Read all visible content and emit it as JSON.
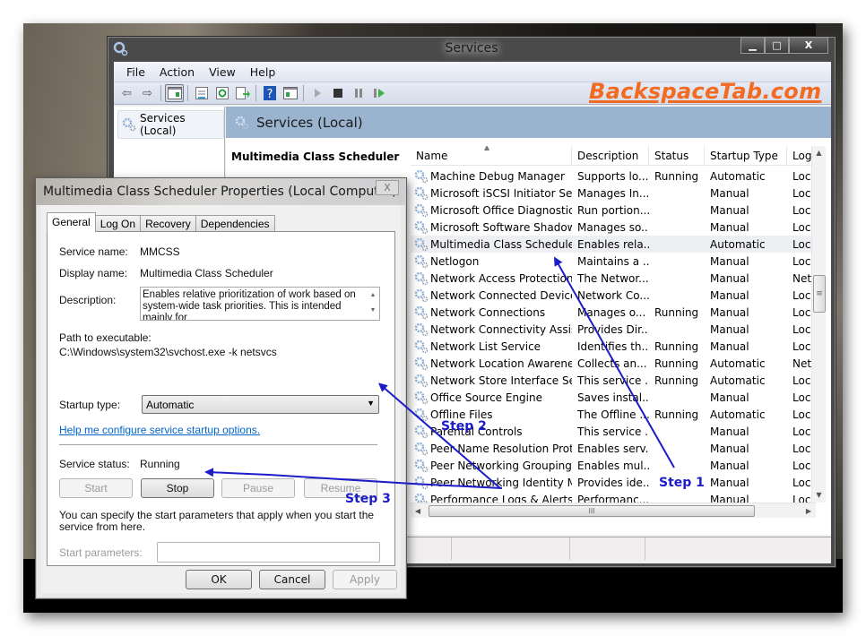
{
  "services_window": {
    "title": "Services",
    "controls": {
      "minimize": "▁",
      "maximize": "□",
      "close": "X"
    },
    "menu": [
      "File",
      "Action",
      "View",
      "Help"
    ],
    "toolbar_icons": [
      "back-arrow-icon",
      "forward-arrow-icon",
      "show-hide-console-tree-icon",
      "properties-icon",
      "refresh-icon",
      "export-list-icon",
      "help-icon",
      "show-hide-action-pane-icon",
      "start-service-icon",
      "stop-service-icon",
      "pause-service-icon",
      "restart-service-icon"
    ],
    "watermark": "BackspaceTab.com",
    "brand_color": "#f36a21",
    "tree": {
      "root": "Services (Local)"
    },
    "content_header": "Services (Local)",
    "selected_detail_title": "Multimedia Class Scheduler",
    "columns": [
      "Name",
      "Description",
      "Status",
      "Startup Type",
      "Log"
    ],
    "rows": [
      {
        "name": "Machine Debug Manager",
        "description": "Supports lo...",
        "status": "Running",
        "startup": "Automatic",
        "log": "Loc"
      },
      {
        "name": "Microsoft iSCSI Initiator Ser...",
        "description": "Manages In...",
        "status": "",
        "startup": "Manual",
        "log": "Loc"
      },
      {
        "name": "Microsoft Office Diagnostic...",
        "description": "Run portion...",
        "status": "",
        "startup": "Manual",
        "log": "Loc"
      },
      {
        "name": "Microsoft Software Shadow...",
        "description": "Manages so...",
        "status": "",
        "startup": "Manual",
        "log": "Loc"
      },
      {
        "name": "Multimedia Class Scheduler",
        "description": "Enables rela...",
        "status": "",
        "startup": "Automatic",
        "log": "Loc",
        "selected": true
      },
      {
        "name": "Netlogon",
        "description": "Maintains a ...",
        "status": "",
        "startup": "Manual",
        "log": "Loc"
      },
      {
        "name": "Network Access Protection ...",
        "description": "The Networ...",
        "status": "",
        "startup": "Manual",
        "log": "Net"
      },
      {
        "name": "Network Connected Device...",
        "description": "Network Co...",
        "status": "",
        "startup": "Manual",
        "log": "Loc"
      },
      {
        "name": "Network Connections",
        "description": "Manages o...",
        "status": "Running",
        "startup": "Manual",
        "log": "Loc"
      },
      {
        "name": "Network Connectivity Assis...",
        "description": "Provides Dir...",
        "status": "",
        "startup": "Manual",
        "log": "Loc"
      },
      {
        "name": "Network List Service",
        "description": "Identifies th...",
        "status": "Running",
        "startup": "Manual",
        "log": "Loc"
      },
      {
        "name": "Network Location Awareness",
        "description": "Collects an...",
        "status": "Running",
        "startup": "Automatic",
        "log": "Net"
      },
      {
        "name": "Network Store Interface Ser...",
        "description": "This service ...",
        "status": "Running",
        "startup": "Automatic",
        "log": "Loc"
      },
      {
        "name": "Office Source Engine",
        "description": "Saves instal...",
        "status": "",
        "startup": "Manual",
        "log": "Loc"
      },
      {
        "name": "Offline Files",
        "description": "The Offline ...",
        "status": "Running",
        "startup": "Automatic",
        "log": "Loc"
      },
      {
        "name": "Parental Controls",
        "description": "This service ...",
        "status": "",
        "startup": "Manual",
        "log": "Loc"
      },
      {
        "name": "Peer Name Resolution Prot...",
        "description": "Enables serv...",
        "status": "",
        "startup": "Manual",
        "log": "Loc"
      },
      {
        "name": "Peer Networking Grouping",
        "description": "Enables mul...",
        "status": "",
        "startup": "Manual",
        "log": "Loc"
      },
      {
        "name": "Peer Networking Identity M...",
        "description": "Provides ide...",
        "status": "",
        "startup": "Manual",
        "log": "Loc"
      },
      {
        "name": "Performance Logs & Alerts",
        "description": "Performanc...",
        "status": "",
        "startup": "Manual",
        "log": "Loc"
      }
    ]
  },
  "properties_dialog": {
    "title": "Multimedia Class Scheduler Properties (Local Computer)",
    "close": "X",
    "tabs": [
      "General",
      "Log On",
      "Recovery",
      "Dependencies"
    ],
    "active_tab": "General",
    "service_name_label": "Service name:",
    "service_name": "MMCSS",
    "display_name_label": "Display name:",
    "display_name": "Multimedia Class Scheduler",
    "description_label": "Description:",
    "description": "Enables relative prioritization of work based on system-wide task priorities. This is intended mainly for",
    "path_label": "Path to executable:",
    "path": "C:\\Windows\\system32\\svchost.exe -k netsvcs",
    "startup_type_label": "Startup type:",
    "startup_type": "Automatic",
    "help_link": "Help me configure service startup options.",
    "service_status_label": "Service status:",
    "service_status": "Running",
    "buttons": {
      "start": "Start",
      "stop": "Stop",
      "pause": "Pause",
      "resume": "Resume"
    },
    "start_params_note": "You can specify the start parameters that apply when you start the service from here.",
    "start_params_label": "Start parameters:",
    "start_params_value": "",
    "footer": {
      "ok": "OK",
      "cancel": "Cancel",
      "apply": "Apply"
    }
  },
  "annotations": {
    "color": "#1c1cc8",
    "steps": [
      "Step 1",
      "Step 2",
      "Step 3"
    ]
  }
}
